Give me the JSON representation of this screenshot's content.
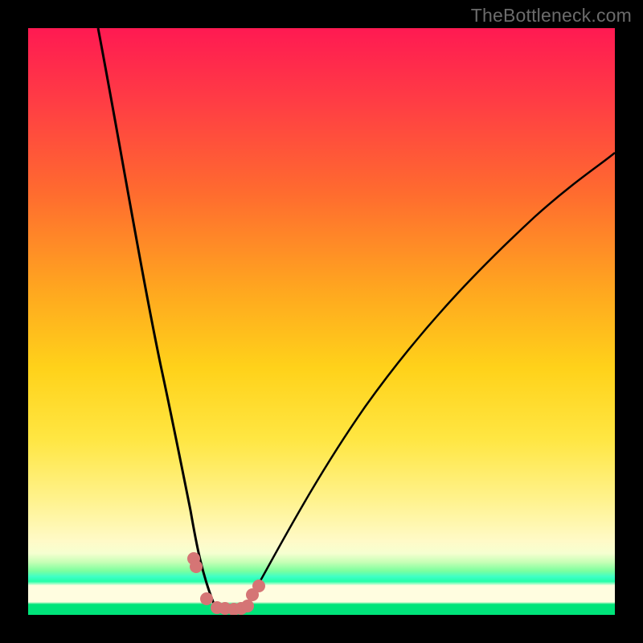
{
  "watermark": {
    "text": "TheBottleneck.com"
  },
  "colors": {
    "frame": "#000000",
    "curve": "#000000",
    "marker": "#d57575",
    "gradient_top": "#ff1a52",
    "gradient_bottom": "#00e47a"
  },
  "chart_data": {
    "type": "line",
    "title": "",
    "xlabel": "",
    "ylabel": "",
    "xlim": [
      0,
      100
    ],
    "ylim": [
      0,
      100
    ],
    "grid": false,
    "legend": false,
    "series": [
      {
        "name": "left-branch",
        "x": [
          12,
          15,
          18,
          20,
          22,
          24,
          25.5,
          27,
          28,
          29,
          30.5,
          32
        ],
        "y": [
          100,
          83,
          66,
          54,
          42,
          30,
          21,
          13.5,
          9,
          5.5,
          2.5,
          1.2
        ]
      },
      {
        "name": "right-branch",
        "x": [
          37,
          39,
          42,
          46,
          51,
          57,
          64,
          72,
          80,
          88,
          96,
          100
        ],
        "y": [
          1.2,
          3.5,
          8,
          15,
          23,
          32,
          42,
          52,
          61,
          69,
          76,
          79
        ]
      },
      {
        "name": "valley-floor",
        "x": [
          32,
          33.5,
          35,
          36,
          37
        ],
        "y": [
          1.2,
          0.9,
          0.85,
          0.9,
          1.2
        ]
      }
    ],
    "markers": {
      "name": "dot-cluster",
      "x": [
        28.3,
        28.7,
        30.4,
        32.2,
        33.6,
        35.0,
        36.3,
        37.3,
        38.2,
        39.3
      ],
      "y": [
        9.6,
        8.3,
        2.7,
        1.3,
        1.1,
        1.05,
        1.15,
        1.5,
        3.4,
        5.0
      ]
    }
  }
}
